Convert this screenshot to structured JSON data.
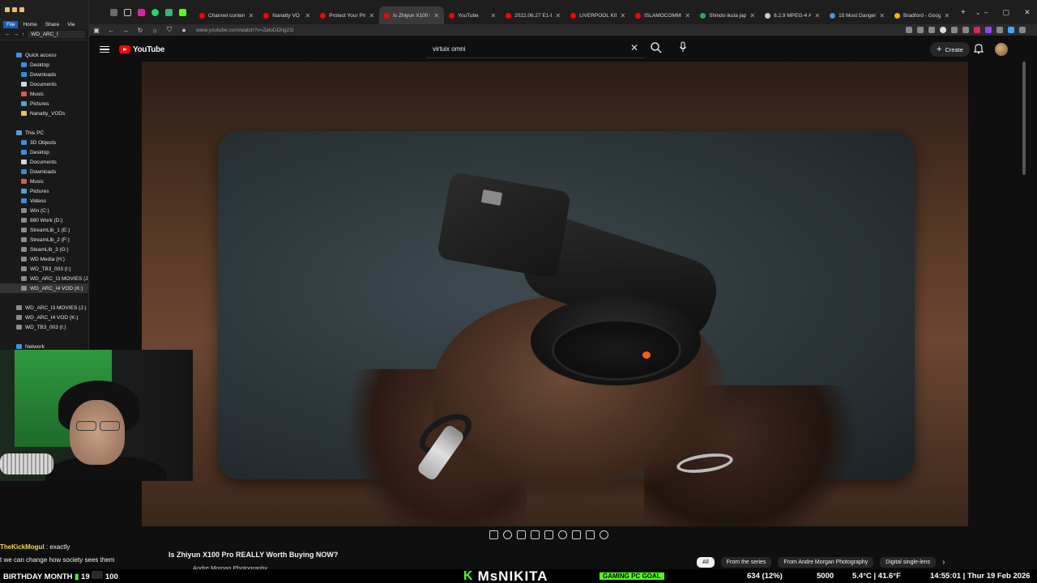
{
  "explorer": {
    "ribbon": {
      "file": "File",
      "home": "Home",
      "share": "Share",
      "view": "Vie"
    },
    "path": "WD_ARC_I",
    "items": [
      {
        "label": "Quick access",
        "icon": "star"
      },
      {
        "label": "Desktop",
        "icon": "blue"
      },
      {
        "label": "Downloads",
        "icon": "dl"
      },
      {
        "label": "Documents",
        "icon": "doc"
      },
      {
        "label": "Music",
        "icon": "music"
      },
      {
        "label": "Pictures",
        "icon": "pic"
      },
      {
        "label": "Nanatty_VODs",
        "icon": "fold"
      },
      {
        "label": "",
        "icon": ""
      },
      {
        "label": "This PC",
        "icon": "pc"
      },
      {
        "label": "3D Objects",
        "icon": "blue"
      },
      {
        "label": "Desktop",
        "icon": "blue"
      },
      {
        "label": "Documents",
        "icon": "doc"
      },
      {
        "label": "Downloads",
        "icon": "dl"
      },
      {
        "label": "Music",
        "icon": "music"
      },
      {
        "label": "Pictures",
        "icon": "pic"
      },
      {
        "label": "Videos",
        "icon": "blue"
      },
      {
        "label": "Win (C:)",
        "icon": "drive"
      },
      {
        "label": "880 Work (D:)",
        "icon": "drive"
      },
      {
        "label": "StreamLib_1 (E:)",
        "icon": "drive"
      },
      {
        "label": "StreamLib_2 (F:)",
        "icon": "drive"
      },
      {
        "label": "SteamLib_3 (G:)",
        "icon": "drive"
      },
      {
        "label": "WD Media (H:)",
        "icon": "drive"
      },
      {
        "label": "WD_TB3_003 (I:)",
        "icon": "drive"
      },
      {
        "label": "WD_ARC_I3 MOVIES (J:)",
        "icon": "drive"
      },
      {
        "label": "WD_ARC_I4 VOD (K:)",
        "icon": "drive",
        "selected": true
      },
      {
        "label": "",
        "icon": ""
      },
      {
        "label": "WD_ARC_I3 MOVIES (J:)",
        "icon": "drive"
      },
      {
        "label": "WD_ARC_I4 VOD (K:)",
        "icon": "drive"
      },
      {
        "label": "WD_TB3_003 (I:)",
        "icon": "drive"
      },
      {
        "label": "",
        "icon": ""
      },
      {
        "label": "Network",
        "icon": "net"
      }
    ]
  },
  "browser": {
    "tabs": [
      {
        "label": "Channel conten",
        "color": "#ff0000"
      },
      {
        "label": "Nanatty VO",
        "color": "#ff0000"
      },
      {
        "label": "Protect Your Pri",
        "color": "#ff0000"
      },
      {
        "label": "Is Zhiyun X100 P",
        "color": "#ff0000",
        "active": true
      },
      {
        "label": "YouTube",
        "color": "#ff0000"
      },
      {
        "label": "2022.06.27 E1-E",
        "color": "#ff0000"
      },
      {
        "label": "LIVERPOOL KID",
        "color": "#ff0000"
      },
      {
        "label": "ISLAMOCOMMI",
        "color": "#ff0000"
      },
      {
        "label": "Shindo ikuta jap",
        "color": "#34a853"
      },
      {
        "label": "8.2.9 MPEG-4 A",
        "color": "#cccccc"
      },
      {
        "label": "15 Most Danger",
        "color": "#4a90d9"
      },
      {
        "label": "Bradford - Goog",
        "color": "#f4b400"
      }
    ],
    "url": "www.youtube.com/watch?v=ZaloDDhg21I"
  },
  "youtube": {
    "logo": "YouTube",
    "search_value": "virtuix omni",
    "create_label": "Create",
    "video_title": "Is Zhiyun X100 Pro REALLY Worth Buying NOW?",
    "channel": "Andre Morgan Photography",
    "chips": [
      "All",
      "From the series",
      "From Andre Morgan Photography",
      "Digital single-lens"
    ]
  },
  "stream": {
    "chat_user": "TheKickMogul",
    "chat_msg": ": exactly",
    "chat_line2": "t we can change how society sees them",
    "ticker_left": "BIRTHDAY MONTH",
    "ticker_mid1": "19",
    "ticker_mid2": "100",
    "streamer_k": "K",
    "streamer_name": "MsNIKITA",
    "goal": "GAMING PC GOAL",
    "goal_count": "634 (12%)",
    "goal_total": "5000",
    "weather": "5.4°C | 41.6°F",
    "datetime": "14:55:01 | Thur 19 Feb 2026"
  },
  "colors": {
    "accent": "#ff0000",
    "kick_green": "#53fc18",
    "chat_user": "#f7d54a"
  }
}
